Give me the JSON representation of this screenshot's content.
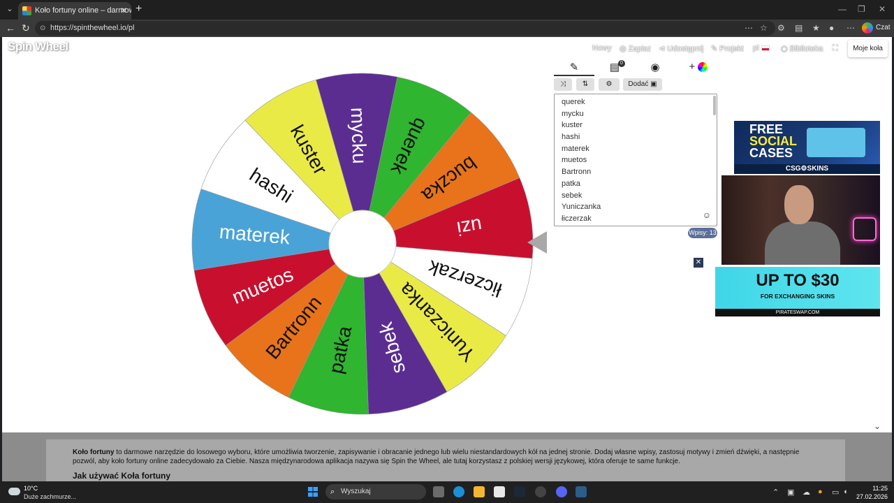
{
  "browser": {
    "tab_title": "Koło fortuny online – darmowe koło",
    "url": "https://spinthewheel.io/pl",
    "copilot_label": "Czat"
  },
  "header": {
    "logo": "Spin Wheel",
    "nav": [
      "Nowy",
      "Zapisz",
      "Udostępnij",
      "Projekt",
      "pl",
      "Biblioteka"
    ],
    "my_wheels": "Moje koła"
  },
  "wheel": {
    "segments": [
      {
        "label": "mycku",
        "color": "#5b2d91"
      },
      {
        "label": "querek",
        "color": "#2fb52f"
      },
      {
        "label": "buczka",
        "color": "#e8731a"
      },
      {
        "label": "uzi",
        "color": "#c8102e"
      },
      {
        "label": "łiczerzak",
        "color": "#ffffff"
      },
      {
        "label": "Yuniczanka",
        "color": "#eaea47"
      },
      {
        "label": "sebek",
        "color": "#5b2d91"
      },
      {
        "label": "patka",
        "color": "#2fb52f"
      },
      {
        "label": "Bartronn",
        "color": "#e8731a"
      },
      {
        "label": "muetos",
        "color": "#c8102e"
      },
      {
        "label": "materek",
        "color": "#4aa3d6"
      },
      {
        "label": "hashi",
        "color": "#ffffff"
      },
      {
        "label": "kuster",
        "color": "#eaea47"
      }
    ]
  },
  "editor": {
    "tabs": [
      "edit",
      "results",
      "hide",
      "add-colors"
    ],
    "results_badge": "0",
    "add_button": "Dodać",
    "entries": [
      "querek",
      "mycku",
      "kuster",
      "hashi",
      "materek",
      "muetos",
      "Bartronn",
      "patka",
      "sebek",
      "Yuniczanka",
      "łiczerzak"
    ],
    "count_label": "Wpisy: 13"
  },
  "ads": {
    "ad1_line1": "FREE",
    "ad1_line2": "SOCIAL",
    "ad1_line3": "CASES",
    "ad1_brand": "CSG⚙SKINS",
    "ad2_big": "UP TO $30",
    "ad2_small": "FOR EXCHANGING SKINS",
    "ad2_foot": "PIRATESWAP.COM"
  },
  "description": {
    "bold": "Koło fortuny",
    "text": " to darmowe narzędzie do losowego wyboru, które umożliwia tworzenie, zapisywanie i obracanie jednego lub wielu niestandardowych kół na jednej stronie. Dodaj własne wpisy, zastosuj motywy i zmień dźwięki, a następnie pozwól, aby koło fortuny online zadecydowało za Ciebie. Nasza międzynarodowa aplikacja nazywa się Spin the Wheel, ale tutaj korzystasz z polskiej wersji językowej, która oferuje te same funkcje.",
    "heading": "Jak używać Koła fortuny"
  },
  "taskbar": {
    "temp": "10°C",
    "condition": "Duże zachmurze...",
    "search": "Wyszukaj",
    "time": "11:25",
    "date": "27.02.2026"
  }
}
